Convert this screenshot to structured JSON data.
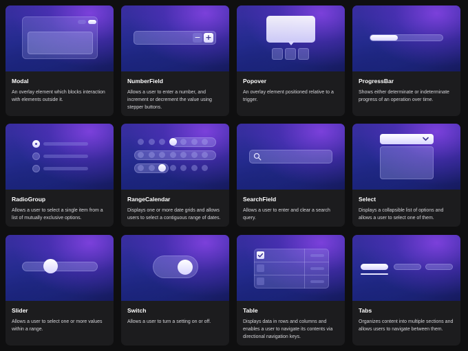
{
  "components": [
    {
      "title": "Modal",
      "description": "An overlay element which blocks interaction with elements outside it."
    },
    {
      "title": "NumberField",
      "description": "Allows a user to enter a number, and increment or decrement the value using stepper buttons."
    },
    {
      "title": "Popover",
      "description": "An overlay element positioned relative to a trigger."
    },
    {
      "title": "ProgressBar",
      "description": "Shows either determinate or indeterminate progress of an operation over time."
    },
    {
      "title": "RadioGroup",
      "description": "Allows a user to select a single item from a list of mutually exclusive options."
    },
    {
      "title": "RangeCalendar",
      "description": "Displays one or more date grids and allows users to select a contiguous range of dates."
    },
    {
      "title": "SearchField",
      "description": "Allows a user to enter and clear a search query."
    },
    {
      "title": "Select",
      "description": "Displays a collapsible list of options and allows a user to select one of them."
    },
    {
      "title": "Slider",
      "description": "Allows a user to select one or more values within a range."
    },
    {
      "title": "Switch",
      "description": "Allows a user to turn a setting on or off."
    },
    {
      "title": "Table",
      "description": "Displays data in rows and columns and enables a user to navigate its contents via directional navigation keys."
    },
    {
      "title": "Tabs",
      "description": "Organizes content into multiple sections and allows users to navigate between them."
    }
  ],
  "numberfield": {
    "minus": "−",
    "plus": "+"
  },
  "icons": {
    "search": "search-icon",
    "chevron": "chevron-down-icon",
    "check": "checkmark-icon"
  }
}
